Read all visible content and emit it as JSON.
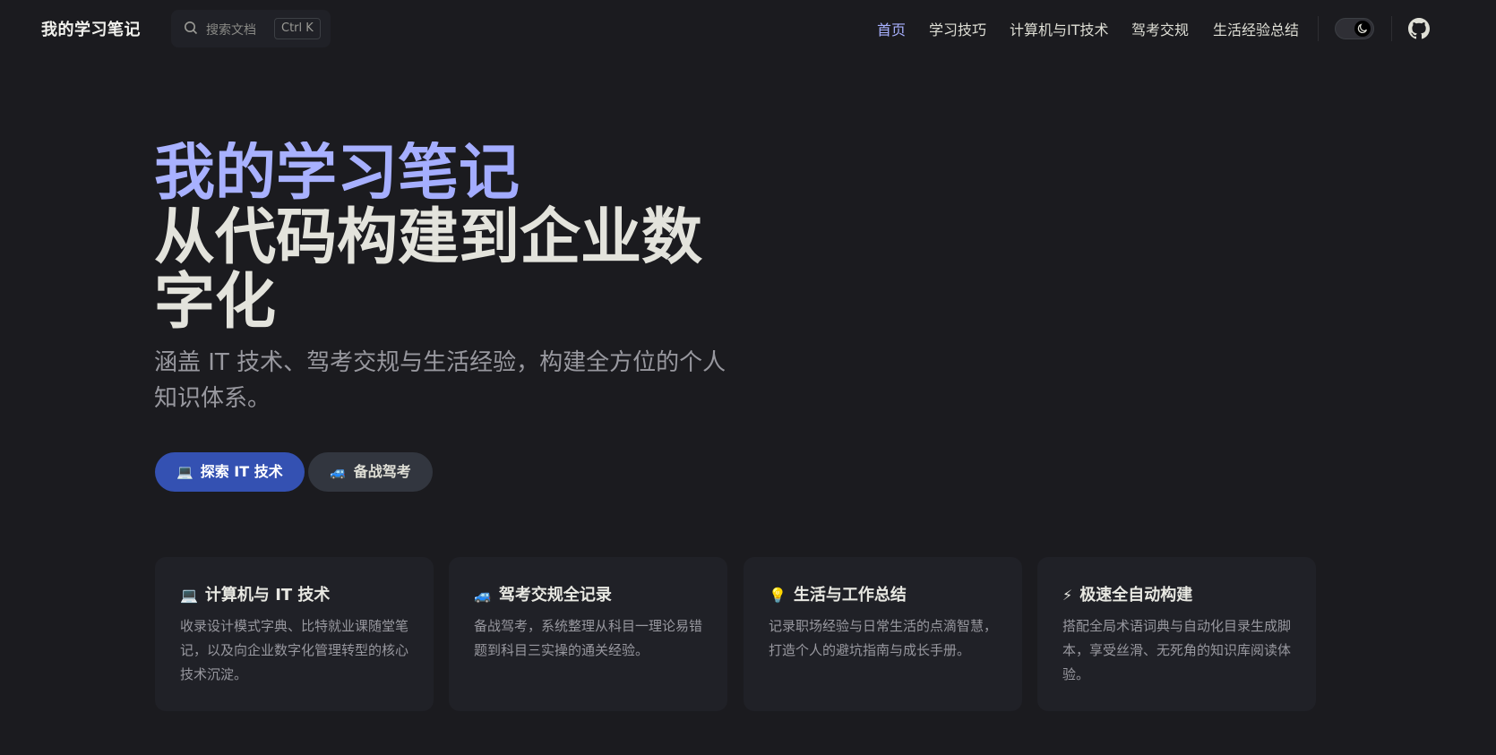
{
  "nav": {
    "brand": "我的学习笔记",
    "search_placeholder": "搜索文档",
    "search_shortcut": "Ctrl K",
    "items": [
      {
        "label": "首页",
        "active": true
      },
      {
        "label": "学习技巧",
        "active": false
      },
      {
        "label": "计算机与IT技术",
        "active": false
      },
      {
        "label": "驾考交规",
        "active": false
      },
      {
        "label": "生活经验总结",
        "active": false
      }
    ],
    "theme": "dark",
    "icons": [
      "search-icon",
      "moon-icon",
      "github-icon"
    ]
  },
  "hero": {
    "name": "我的学习笔记",
    "text": "从代码构建到企业数字化",
    "tagline": "涵盖 IT 技术、驾考交规与生活经验，构建全方位的个人知识体系。",
    "actions": [
      {
        "emoji": "💻",
        "label": "探索 IT 技术",
        "theme": "brand"
      },
      {
        "emoji": "🚙",
        "label": "备战驾考",
        "theme": "alt"
      }
    ]
  },
  "features": [
    {
      "emoji": "💻",
      "title": "计算机与 IT 技术",
      "details": "收录设计模式字典、比特就业课随堂笔记，以及向企业数字化管理转型的核心技术沉淀。"
    },
    {
      "emoji": "🚙",
      "title": "驾考交规全记录",
      "details": "备战驾考，系统整理从科目一理论易错题到科目三实操的通关经验。"
    },
    {
      "emoji": "💡",
      "title": "生活与工作总结",
      "details": "记录职场经验与日常生活的点滴智慧，打造个人的避坑指南与成长手册。"
    },
    {
      "emoji": "⚡",
      "title": "极速全自动构建",
      "details": "搭配全局术语词典与自动化目录生成脚本，享受丝滑、无死角的知识库阅读体验。"
    }
  ],
  "colors": {
    "background": "#1b1b1f",
    "card": "#202127",
    "brand": "#a8b1ff",
    "primary_button": "#3451b2",
    "alt_button": "#32363f"
  }
}
